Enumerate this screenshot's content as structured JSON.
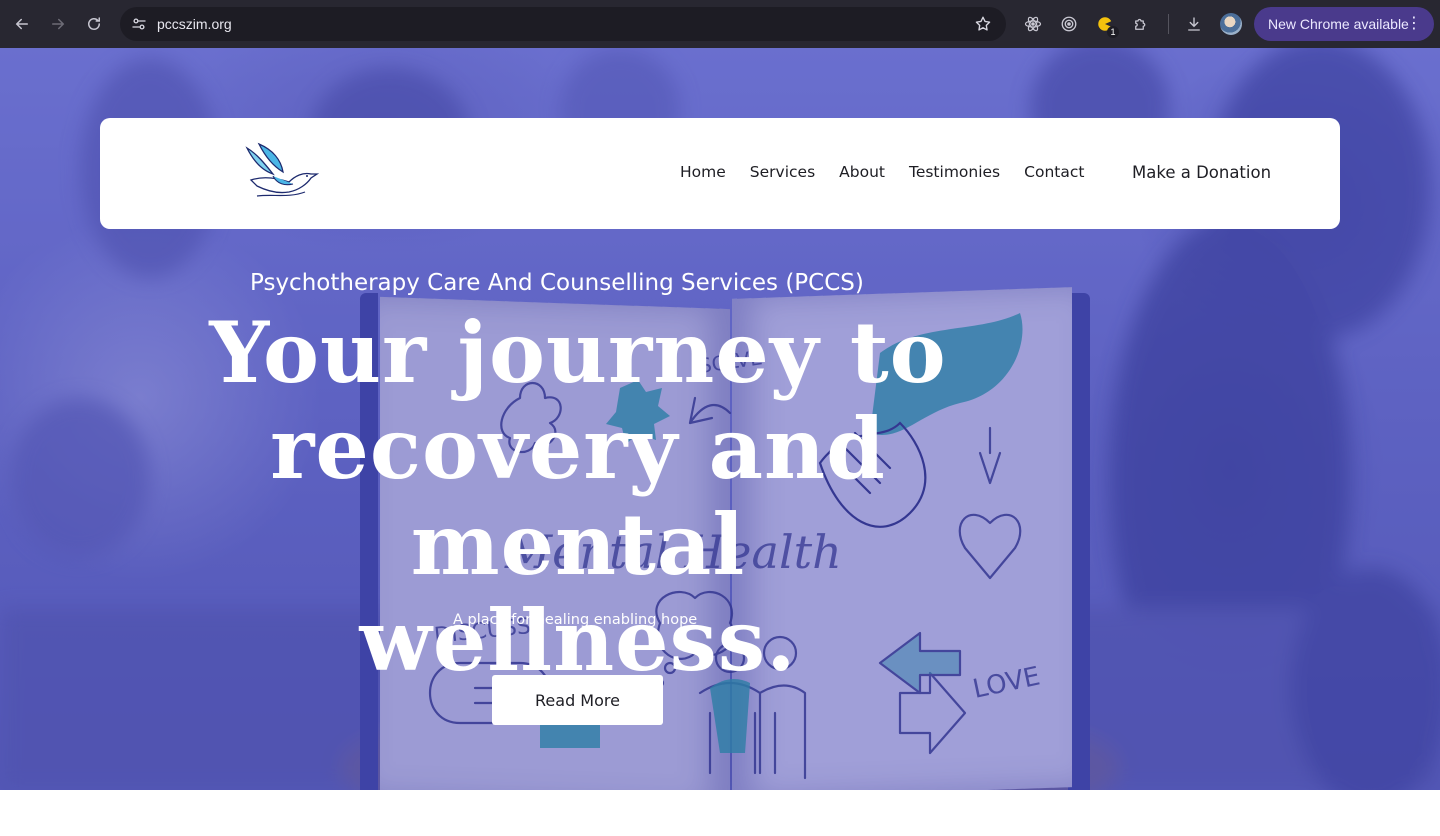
{
  "browser": {
    "url": "pccszim.org",
    "update_label": "New Chrome available",
    "extension_badge": "1",
    "icons": [
      "back-icon",
      "forward-icon",
      "reload-icon",
      "site-info-icon",
      "bookmark-star-icon",
      "react-devtools-icon",
      "target-icon",
      "extension-badge-icon",
      "puzzle-icon",
      "download-icon",
      "profile-avatar",
      "more-vert-icon"
    ]
  },
  "header": {
    "logo_icon": "dove-logo-icon",
    "nav": [
      "Home",
      "Services",
      "About",
      "Testimonies",
      "Contact"
    ],
    "donate_label": "Make a Donation"
  },
  "hero": {
    "eyebrow": "Psychotherapy Care And Counselling Services (PCCS)",
    "headline": "Your journey to recovery and mental wellness.",
    "tagline": "A place for healing enabling hope",
    "cta_label": "Read More",
    "background_words": [
      "SOLVE",
      "Mental Health",
      "DISCUSS",
      "LOVE"
    ]
  },
  "colors": {
    "overlay": "#484abe",
    "header_bg": "#ffffff",
    "teal_accent": "#1f9a9a",
    "chrome_bg": "#282731",
    "update_pill": "#4a3a8c"
  }
}
